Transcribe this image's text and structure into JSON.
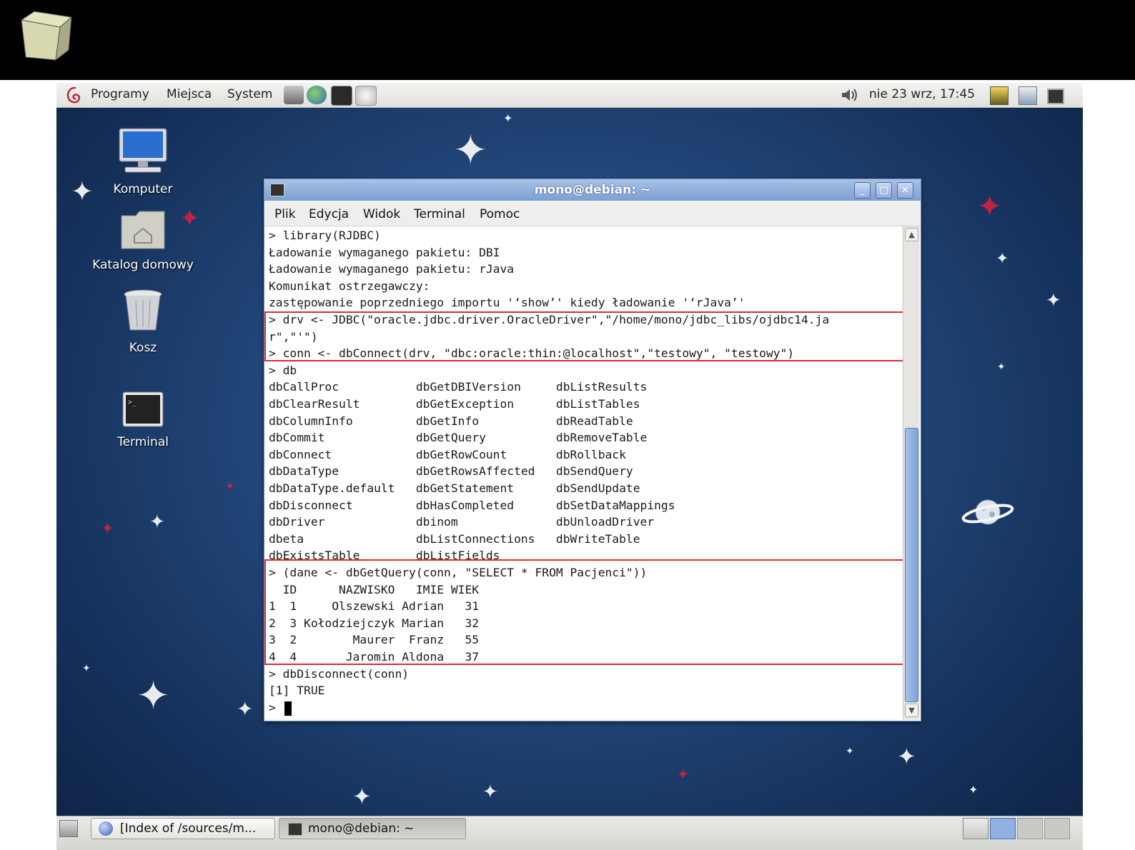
{
  "top_panel": {
    "menu_applications": "Programy",
    "menu_places": "Miejsca",
    "menu_system": "System",
    "clock": "nie 23 wrz, 17:45"
  },
  "desktop_icons": [
    {
      "label": "Komputer"
    },
    {
      "label": "Katalog domowy"
    },
    {
      "label": "Kosz"
    },
    {
      "label": "Terminal"
    }
  ],
  "window": {
    "title": "mono@debian: ~",
    "menu": [
      "Plik",
      "Edycja",
      "Widok",
      "Terminal",
      "Pomoc"
    ]
  },
  "terminal_lines": [
    "> library(RJDBC)",
    "Ładowanie wymaganego pakietu: DBI",
    "Ładowanie wymaganego pakietu: rJava",
    "Komunikat ostrzegawczy:",
    "zastępowanie poprzedniego importu '‘show’' kiedy ładowanie '‘rJava’'",
    "> drv <- JDBC(\"oracle.jdbc.driver.OracleDriver\",\"/home/mono/jdbc_libs/ojdbc14.ja",
    "r\",\"'\")",
    "> conn <- dbConnect(drv, \"dbc:oracle:thin:@localhost\",\"testowy\", \"testowy\")",
    "> db",
    "dbCallProc           dbGetDBIVersion     dbListResults",
    "dbClearResult        dbGetException      dbListTables",
    "dbColumnInfo         dbGetInfo           dbReadTable",
    "dbCommit             dbGetQuery          dbRemoveTable",
    "dbConnect            dbGetRowCount       dbRollback",
    "dbDataType           dbGetRowsAffected   dbSendQuery",
    "dbDataType.default   dbGetStatement      dbSendUpdate",
    "dbDisconnect         dbHasCompleted      dbSetDataMappings",
    "dbDriver             dbinom              dbUnloadDriver",
    "dbeta                dbListConnections   dbWriteTable",
    "dbExistsTable        dbListFields",
    "> (dane <- dbGetQuery(conn, \"SELECT * FROM Pacjenci\"))",
    "  ID      NAZWISKO   IMIE WIEK",
    "1  1     Olszewski Adrian   31",
    "2  3 Kołodziejczyk Marian   32",
    "3  2        Maurer  Franz   55",
    "4  4       Jaromin Aldona   37",
    "> dbDisconnect(conn)",
    "[1] TRUE",
    "> "
  ],
  "taskbar": [
    {
      "label": "[Index of /sources/m..."
    },
    {
      "label": "mono@debian: ~"
    }
  ],
  "colors": {
    "highlight": "#e32a2a",
    "titlebar": "#8fadda",
    "desktop": "#1d3d6e"
  }
}
